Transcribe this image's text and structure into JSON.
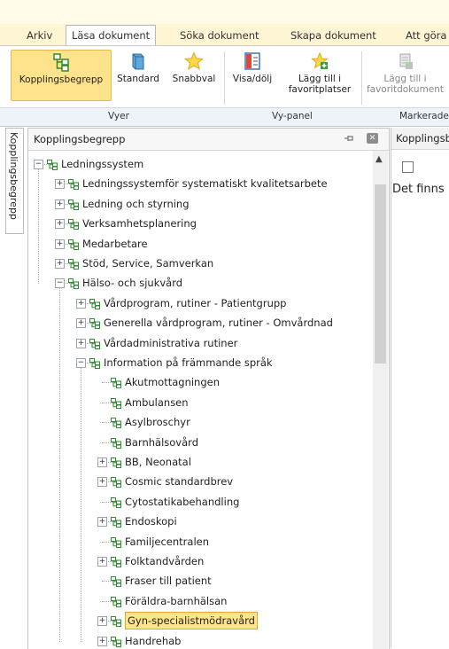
{
  "tabs": [
    "Arkiv",
    "Läsa dokument",
    "Söka dokument",
    "Skapa dokument",
    "Att göra"
  ],
  "ribbon": {
    "buttons": [
      {
        "label": "Kopplingsbegrepp",
        "icon": "tree-structure-icon"
      },
      {
        "label": "Standard",
        "icon": "book-icon"
      },
      {
        "label": "Snabbval",
        "icon": "star-icon"
      },
      {
        "label": "Visa/dölj",
        "icon": "panel-toggle-icon"
      },
      {
        "label1": "Lägg till i",
        "label2": "favoritplatser",
        "icon": "add-favorite-icon"
      },
      {
        "label1": "Lägg till i",
        "label2": "favoritdokument",
        "icon": "add-favorite-document-icon"
      }
    ],
    "groups": [
      "Vyer",
      "Vy-panel",
      "Markerade"
    ]
  },
  "side_tab": "Kopplingsbegrepp",
  "panel": {
    "title": "Kopplingsbegrepp"
  },
  "tree": [
    {
      "label": "Ledningssystem",
      "exp": "−"
    },
    {
      "label": "Ledningssystemför systematiskt kvalitetsarbete",
      "exp": "+"
    },
    {
      "label": "Ledning och styrning",
      "exp": "+"
    },
    {
      "label": "Verksamhetsplanering",
      "exp": "+"
    },
    {
      "label": "Medarbetare",
      "exp": "+"
    },
    {
      "label": "Stöd, Service, Samverkan",
      "exp": "+"
    },
    {
      "label": "Hälso- och sjukvård",
      "exp": "−"
    },
    {
      "label": "Vårdprogram, rutiner - Patientgrupp",
      "exp": "+"
    },
    {
      "label": "Generella vårdprogram, rutiner - Omvårdnad",
      "exp": "+"
    },
    {
      "label": "Vårdadministrativa rutiner",
      "exp": "+"
    },
    {
      "label": "Information på främmande språk",
      "exp": "−"
    },
    {
      "label": "Akutmottagningen",
      "exp": ""
    },
    {
      "label": "Ambulansen",
      "exp": ""
    },
    {
      "label": "Asylbroschyr",
      "exp": ""
    },
    {
      "label": "Barnhälsovård",
      "exp": ""
    },
    {
      "label": "BB, Neonatal",
      "exp": "+"
    },
    {
      "label": "Cosmic standardbrev",
      "exp": "+"
    },
    {
      "label": "Cytostatikabehandling",
      "exp": ""
    },
    {
      "label": "Endoskopi",
      "exp": "+"
    },
    {
      "label": "Familjecentralen",
      "exp": ""
    },
    {
      "label": "Folktandvården",
      "exp": "+"
    },
    {
      "label": "Fraser till patient",
      "exp": ""
    },
    {
      "label": "Föräldra-barnhälsan",
      "exp": ""
    },
    {
      "label": "Gyn-specialistmödravård",
      "exp": "+",
      "selected": true
    },
    {
      "label": "Handrehab",
      "exp": "+"
    }
  ],
  "right_panel": {
    "header": "Kopplingsbegrepp",
    "message": "Det finns"
  },
  "colors": {
    "selection": "#ffe58a",
    "selection_border": "#d9a934",
    "ribbon_selected": "#ffe28c",
    "node_icon": "#3a9a3a",
    "tab_bar": "#fdf5d4"
  }
}
